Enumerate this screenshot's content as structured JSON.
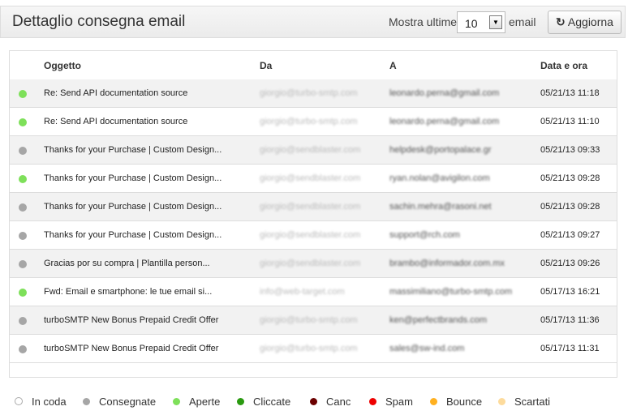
{
  "header": {
    "title": "Dettaglio consegna email",
    "show_label": "Mostra ultime",
    "count": "10",
    "unit": "email",
    "refresh": "Aggiorna"
  },
  "columns": [
    "Oggetto",
    "Da",
    "A",
    "Data e ora"
  ],
  "rows": [
    {
      "status": "#7ee05a",
      "subject": "Re: Send API documentation source",
      "from": "giorgio@turbo-smtp.com",
      "to": "leonardo.perna@gmail.com",
      "date": "05/21/13 11:18"
    },
    {
      "status": "#7ee05a",
      "subject": "Re: Send API documentation source",
      "from": "giorgio@turbo-smtp.com",
      "to": "leonardo.perna@gmail.com",
      "date": "05/21/13 11:10"
    },
    {
      "status": "#a6a6a6",
      "subject": "Thanks for your Purchase | Custom Design...",
      "from": "giorgio@sendblaster.com",
      "to": "helpdesk@portopalace.gr",
      "date": "05/21/13 09:33"
    },
    {
      "status": "#7ee05a",
      "subject": "Thanks for your Purchase | Custom Design...",
      "from": "giorgio@sendblaster.com",
      "to": "ryan.nolan@avigilon.com",
      "date": "05/21/13 09:28"
    },
    {
      "status": "#a6a6a6",
      "subject": "Thanks for your Purchase | Custom Design...",
      "from": "giorgio@sendblaster.com",
      "to": "sachin.mehra@rasoni.net",
      "date": "05/21/13 09:28"
    },
    {
      "status": "#a6a6a6",
      "subject": "Thanks for your Purchase | Custom Design...",
      "from": "giorgio@sendblaster.com",
      "to": "support@rch.com",
      "date": "05/21/13 09:27"
    },
    {
      "status": "#a6a6a6",
      "subject": "Gracias por su compra | Plantilla person...",
      "from": "giorgio@sendblaster.com",
      "to": "brambo@informador.com.mx",
      "date": "05/21/13 09:26"
    },
    {
      "status": "#7ee05a",
      "subject": "Fwd: Email e smartphone: le tue email si...",
      "from": "info@web-target.com",
      "to": "massimiliano@turbo-smtp.com",
      "date": "05/17/13 16:21"
    },
    {
      "status": "#a6a6a6",
      "subject": "turboSMTP New Bonus Prepaid Credit Offer",
      "from": "giorgio@turbo-smtp.com",
      "to": "ken@perfectbrands.com",
      "date": "05/17/13 11:36"
    },
    {
      "status": "#a6a6a6",
      "subject": "turboSMTP New Bonus Prepaid Credit Offer",
      "from": "giorgio@turbo-smtp.com",
      "to": "sales@sw-ind.com",
      "date": "05/17/13 11:31"
    }
  ],
  "legend": [
    {
      "label": "In coda",
      "color": "#ffffff"
    },
    {
      "label": "Consegnate",
      "color": "#a6a6a6"
    },
    {
      "label": "Aperte",
      "color": "#7ee05a"
    },
    {
      "label": "Cliccate",
      "color": "#2a9a10"
    },
    {
      "label": "Canc",
      "color": "#6b0000"
    },
    {
      "label": "Spam",
      "color": "#ee0000"
    },
    {
      "label": "Bounce",
      "color": "#ffb020"
    },
    {
      "label": "Scartati",
      "color": "#fddb9c"
    }
  ]
}
